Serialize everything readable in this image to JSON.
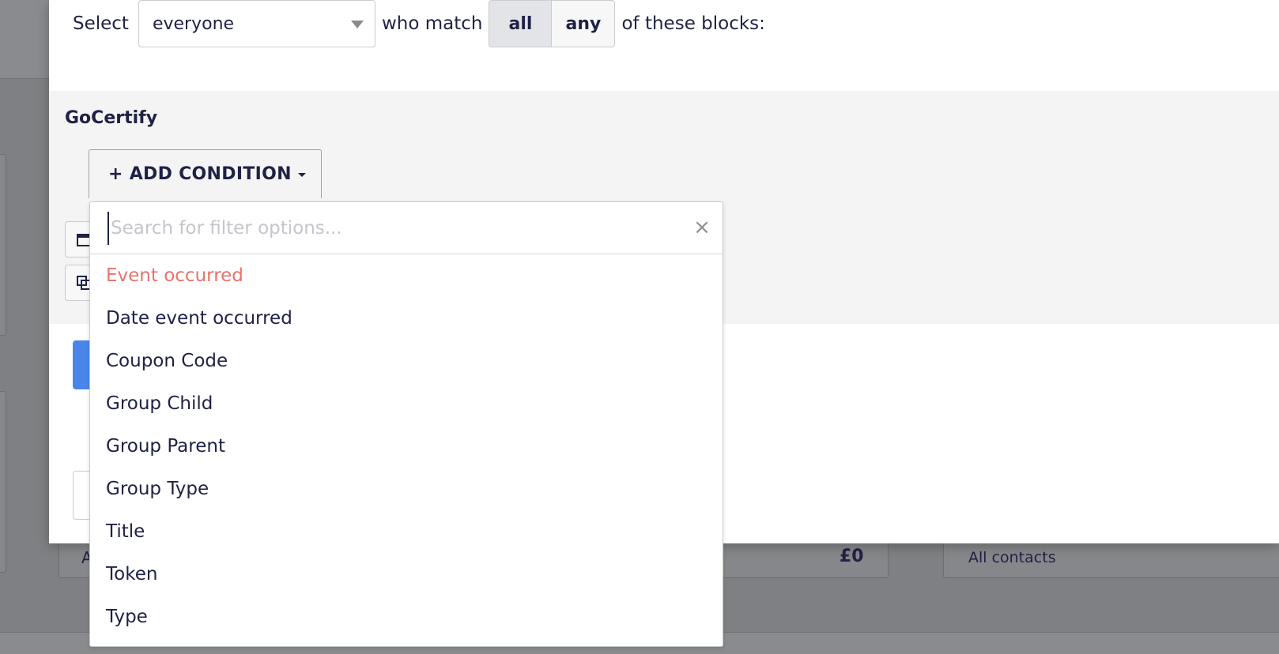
{
  "background": {
    "amount": "£0",
    "contacts_label": "All contacts",
    "partial_text": "A"
  },
  "segment_builder": {
    "select_label": "Select",
    "select_value": "everyone",
    "match_label": "who match",
    "match_options": [
      {
        "label": "all",
        "active": true
      },
      {
        "label": "any",
        "active": false
      }
    ],
    "suffix_label": "of these blocks:"
  },
  "block": {
    "title": "GoCertify",
    "add_condition_label": "+ ADD CONDITION"
  },
  "filter_popup": {
    "search_placeholder": "Search for filter options...",
    "search_value": "",
    "options": [
      {
        "label": "Event occurred",
        "highlighted": true
      },
      {
        "label": "Date event occurred",
        "highlighted": false
      },
      {
        "label": "Coupon Code",
        "highlighted": false
      },
      {
        "label": "Group Child",
        "highlighted": false
      },
      {
        "label": "Group Parent",
        "highlighted": false
      },
      {
        "label": "Group Type",
        "highlighted": false
      },
      {
        "label": "Title",
        "highlighted": false
      },
      {
        "label": "Token",
        "highlighted": false
      },
      {
        "label": "Type",
        "highlighted": false
      }
    ]
  },
  "colors": {
    "text": "#1f2145",
    "highlight": "#e8736b",
    "primary": "#4a86e8",
    "block_bg": "#f4f4f4"
  }
}
